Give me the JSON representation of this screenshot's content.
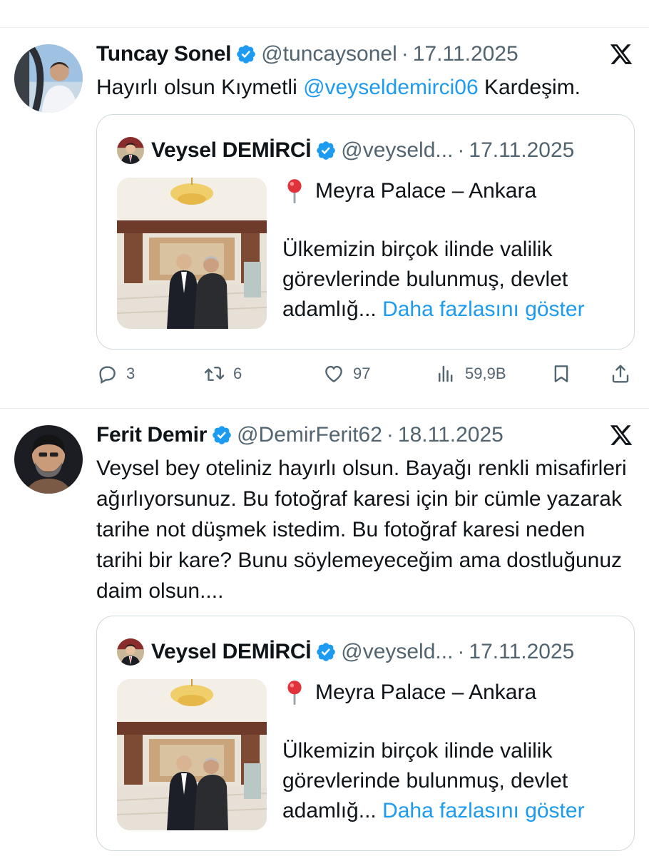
{
  "tweets": [
    {
      "author_name": "Tuncay Sonel",
      "handle": "@tuncaysonel",
      "separator": "·",
      "date": "17.11.2025",
      "text_before": "Hayırlı olsun Kıymetli ",
      "mention": "@veyseldemirci06",
      "text_after": " Kardeşim.",
      "quote": {
        "author_name": "Veysel DEMİRCİ",
        "handle": "@veyseld...",
        "separator": "·",
        "date": "17.11.2025",
        "location": "Meyra Palace – Ankara",
        "body": "Ülkemizin birçok ilinde valilik görevlerinde bulunmuş, devlet adamlığ...",
        "show_more": "Daha fazlasını göster"
      },
      "actions": {
        "replies": "3",
        "reposts": "6",
        "likes": "97",
        "views": "59,9B"
      }
    },
    {
      "author_name": "Ferit Demir",
      "handle": "@DemirFerit62",
      "separator": "·",
      "date": "18.11.2025",
      "text": "Veysel bey oteliniz hayırlı olsun.  Bayağı renkli misafirleri ağırlıyorsunuz. Bu fotoğraf karesi için bir cümle yazarak tarihe not düşmek istedim. Bu fotoğraf karesi neden tarihi bir kare?  Bunu söylemeyeceğim ama dostluğunuz daim olsun....",
      "quote": {
        "author_name": "Veysel DEMİRCİ",
        "handle": "@veyseld...",
        "separator": "·",
        "date": "17.11.2025",
        "location": "Meyra Palace – Ankara",
        "body": "Ülkemizin birçok ilinde valilik görevlerinde bulunmuş, devlet adamlığ...",
        "show_more": "Daha fazlasını göster"
      }
    }
  ],
  "colors": {
    "accent": "#1d9bf0",
    "text": "#0f1419",
    "secondary": "#536471",
    "border": "#cfd9de"
  },
  "icons": [
    "verified-badge-icon",
    "x-logo-icon",
    "location-pin-icon",
    "reply-icon",
    "repost-icon",
    "like-icon",
    "views-icon",
    "bookmark-icon",
    "share-icon"
  ]
}
